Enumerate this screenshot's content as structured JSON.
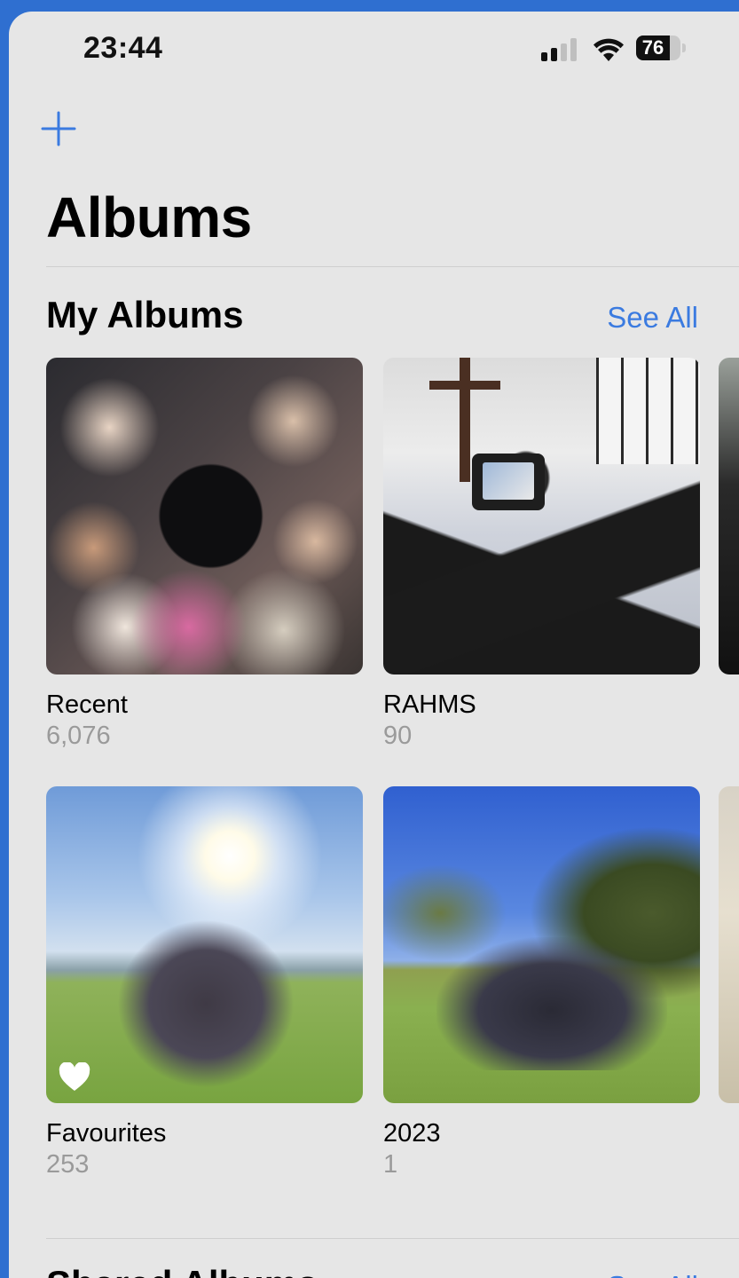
{
  "status_bar": {
    "time": "23:44",
    "battery_percent": "76",
    "battery_level": 0.76
  },
  "header": {
    "title": "Albums",
    "add_icon": "plus-icon"
  },
  "my_albums": {
    "title": "My Albums",
    "see_all": "See All",
    "albums": [
      {
        "title": "Recent",
        "count": "6,076"
      },
      {
        "title": "RAHMS",
        "count": "90"
      },
      {
        "title": "Favourites",
        "count": "253"
      },
      {
        "title": "2023",
        "count": "1"
      }
    ]
  },
  "shared_albums": {
    "title": "Shared Albums",
    "see_all": "See All"
  },
  "colors": {
    "accent": "#3b7be0",
    "background": "#e6e6e6",
    "secondary_text": "#9a9a9a"
  }
}
